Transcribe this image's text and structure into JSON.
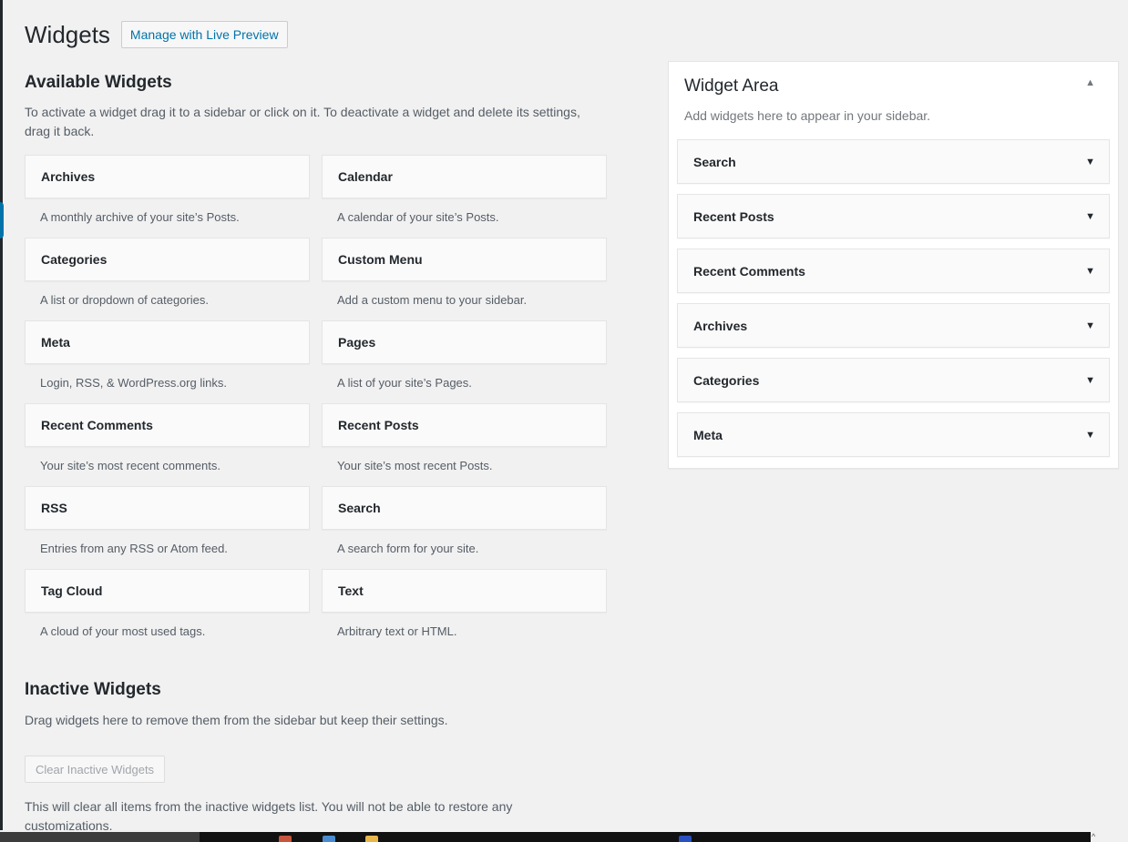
{
  "page": {
    "title": "Widgets",
    "live_preview_label": "Manage with Live Preview"
  },
  "available": {
    "title": "Available Widgets",
    "description": "To activate a widget drag it to a sidebar or click on it. To deactivate a widget and delete its settings, drag it back.",
    "widgets": [
      {
        "name": "Archives",
        "desc": "A monthly archive of your site’s Posts."
      },
      {
        "name": "Calendar",
        "desc": "A calendar of your site’s Posts."
      },
      {
        "name": "Categories",
        "desc": "A list or dropdown of categories."
      },
      {
        "name": "Custom Menu",
        "desc": "Add a custom menu to your sidebar."
      },
      {
        "name": "Meta",
        "desc": "Login, RSS, & WordPress.org links."
      },
      {
        "name": "Pages",
        "desc": "A list of your site’s Pages."
      },
      {
        "name": "Recent Comments",
        "desc": "Your site’s most recent comments."
      },
      {
        "name": "Recent Posts",
        "desc": "Your site’s most recent Posts."
      },
      {
        "name": "RSS",
        "desc": "Entries from any RSS or Atom feed."
      },
      {
        "name": "Search",
        "desc": "A search form for your site."
      },
      {
        "name": "Tag Cloud",
        "desc": "A cloud of your most used tags."
      },
      {
        "name": "Text",
        "desc": "Arbitrary text or HTML."
      }
    ]
  },
  "inactive": {
    "title": "Inactive Widgets",
    "description": "Drag widgets here to remove them from the sidebar but keep their settings.",
    "clear_label": "Clear Inactive Widgets",
    "clear_note": "This will clear all items from the inactive widgets list. You will not be able to restore any customizations."
  },
  "widget_area": {
    "title": "Widget Area",
    "description": "Add widgets here to appear in your sidebar.",
    "toggle_icon": "triangle-up-icon",
    "items": [
      {
        "label": "Search"
      },
      {
        "label": "Recent Posts"
      },
      {
        "label": "Recent Comments"
      },
      {
        "label": "Archives"
      },
      {
        "label": "Categories"
      },
      {
        "label": "Meta"
      }
    ]
  },
  "colors": {
    "accent": "#0073aa",
    "background": "#f1f1f1",
    "text": "#23282d",
    "muted": "#555d66"
  }
}
